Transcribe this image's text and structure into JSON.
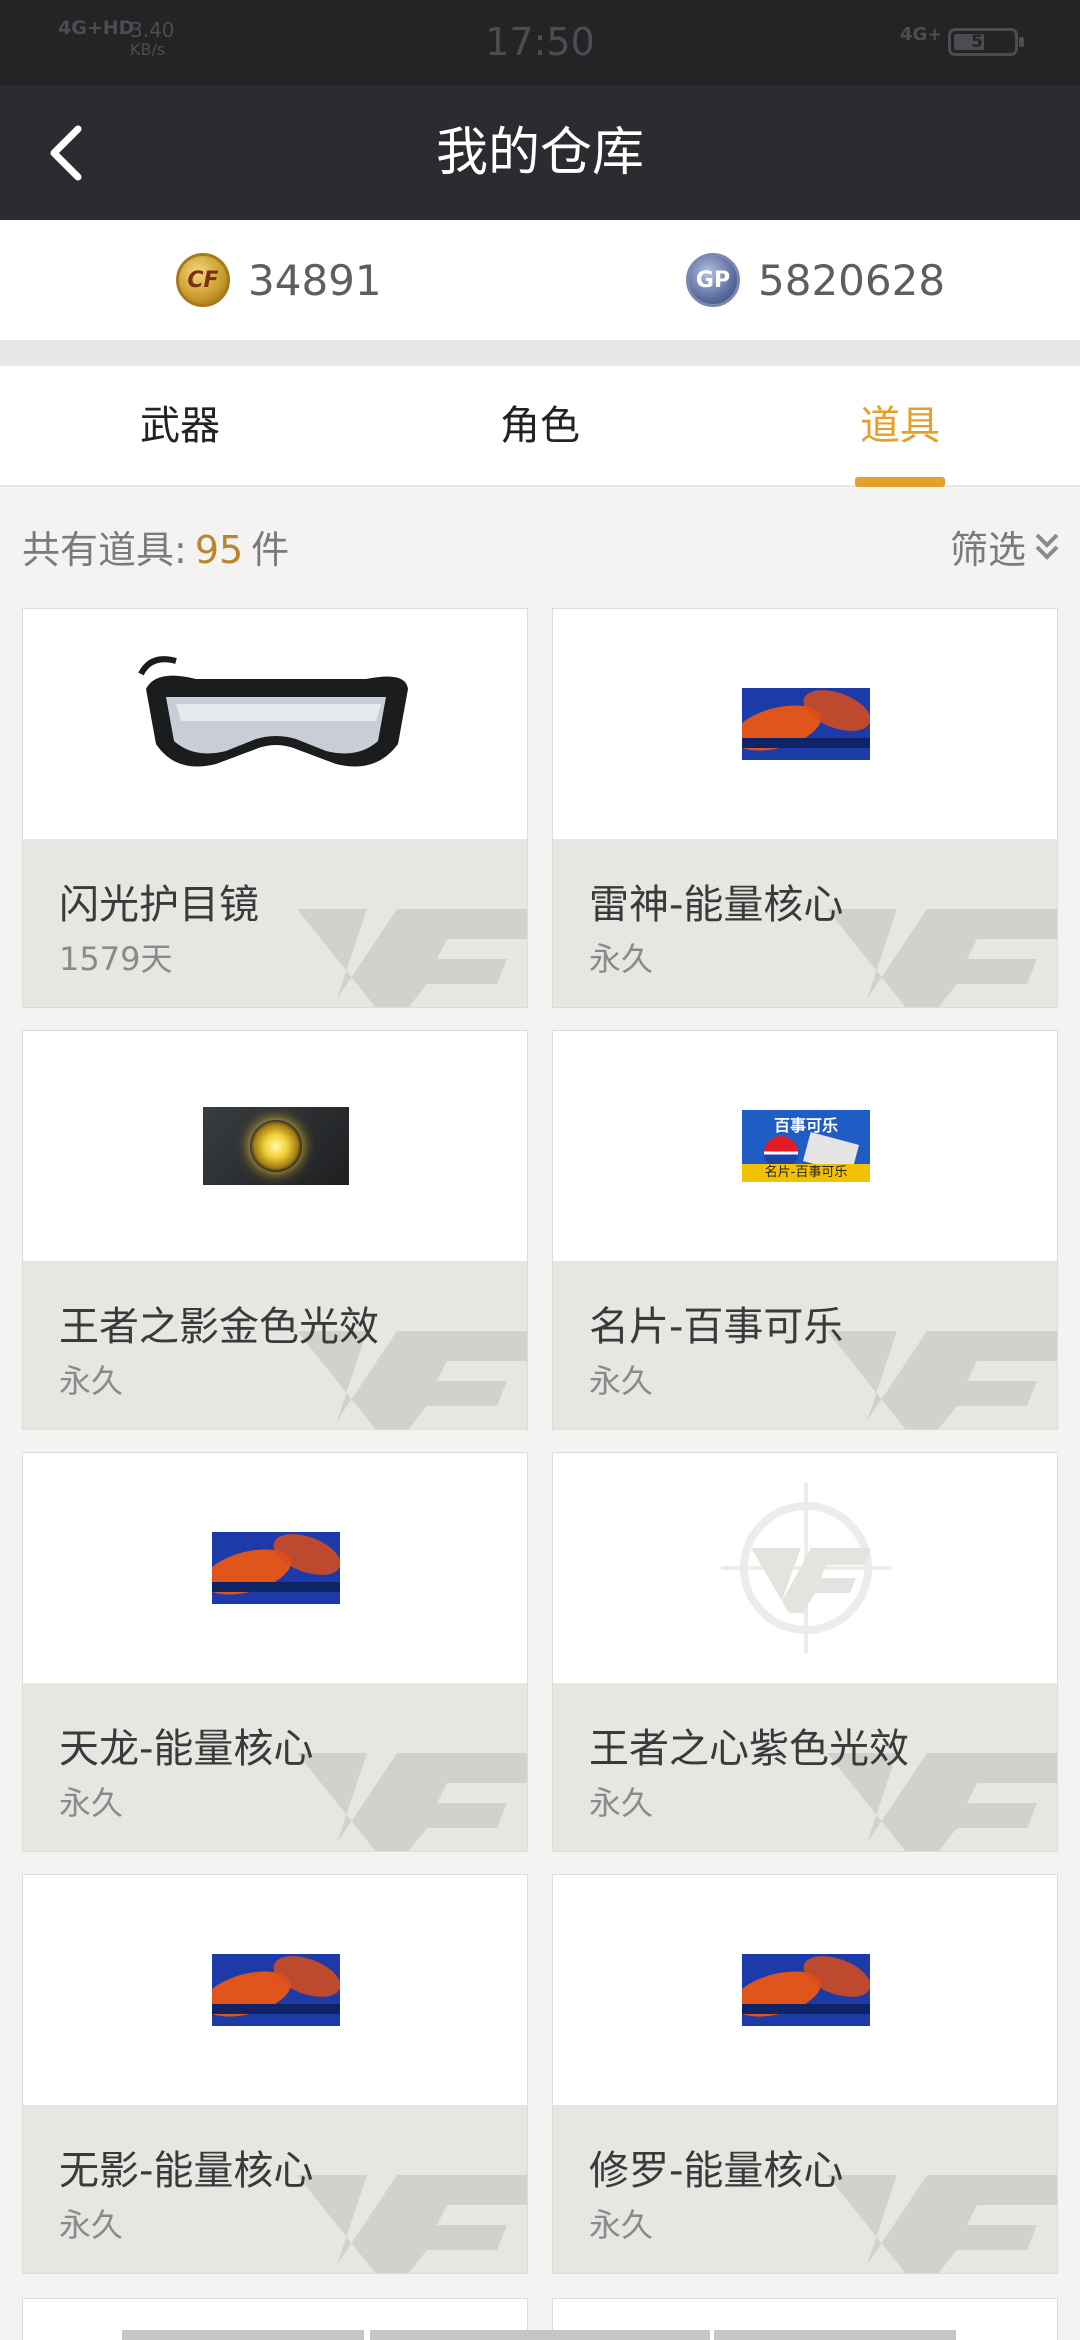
{
  "status_bar": {
    "network_left": "4G+HD",
    "speed_value": "3.40",
    "speed_unit": "KB/s",
    "time": "17:50",
    "network_right": "4G+",
    "battery_level": "50"
  },
  "header": {
    "title": "我的仓库",
    "back_icon": "chevron-left-icon"
  },
  "currency": {
    "cf_points": "34891",
    "gp_points": "5820628",
    "cf_icon_text": "CF",
    "gp_icon_text": "GP"
  },
  "tabs": [
    {
      "label": "武器",
      "active": false
    },
    {
      "label": "角色",
      "active": false
    },
    {
      "label": "道具",
      "active": true
    }
  ],
  "summary": {
    "prefix": "共有道具:",
    "count": "95",
    "suffix": "件",
    "filter_label": "筛选"
  },
  "items": [
    {
      "name": "闪光护目镜",
      "duration": "1579天",
      "thumb": "goggles"
    },
    {
      "name": "雷神-能量核心",
      "duration": "永久",
      "thumb": "energy-core"
    },
    {
      "name": "王者之影金色光效",
      "duration": "永久",
      "thumb": "gold-effect"
    },
    {
      "name": "名片-百事可乐",
      "duration": "永久",
      "thumb": "pepsi-card"
    },
    {
      "name": "天龙-能量核心",
      "duration": "永久",
      "thumb": "energy-core"
    },
    {
      "name": "王者之心紫色光效",
      "duration": "永久",
      "thumb": "cf-placeholder"
    },
    {
      "name": "无影-能量核心",
      "duration": "永久",
      "thumb": "energy-core"
    },
    {
      "name": "修罗-能量核心",
      "duration": "永久",
      "thumb": "energy-core"
    }
  ],
  "pepsi_thumb": {
    "top_text": "百事可乐",
    "bottom_text": "名片-百事可乐"
  },
  "colors": {
    "accent": "#e5a02a",
    "count": "#b8862c",
    "header_bg": "#2b2c2f",
    "status_bg": "#222426"
  }
}
